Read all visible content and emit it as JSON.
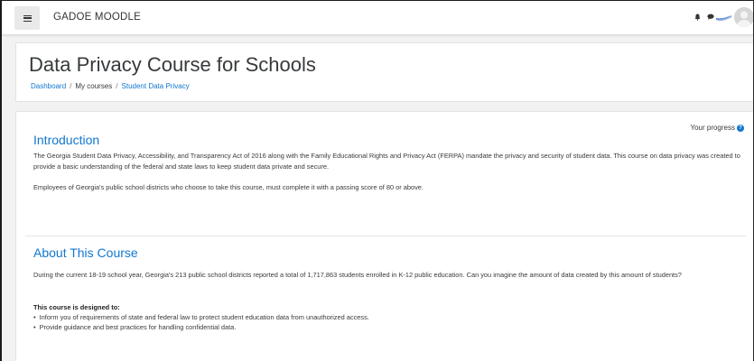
{
  "navbar": {
    "menu_icon": "hamburger-menu-icon",
    "brand": "GADOE MOODLE",
    "notifications_icon": "bell-icon",
    "messages_icon": "chat-bubble-icon",
    "avatar_icon": "user-avatar-icon"
  },
  "header": {
    "title": "Data Privacy Course for Schools",
    "breadcrumb": {
      "home": "Dashboard",
      "my_courses": "My courses",
      "current": "Student Data Privacy",
      "separator": "/"
    }
  },
  "main": {
    "progress_label": "Your progress",
    "progress_help_glyph": "?",
    "sections": [
      {
        "heading": "Introduction",
        "paragraphs": [
          "The Georgia Student Data Privacy, Accessibility, and Transparency Act of 2016 along with the Family Educational Rights and Privacy Act (FERPA) mandate the privacy and security of student data.  This course on data privacy was created to provide a basic understanding of the federal and state laws to keep student data private and secure.",
          "Employees of Georgia's public school districts who choose to take this course, must complete it with a passing score of 80 or above."
        ]
      },
      {
        "heading": "About This Course",
        "paragraphs": [
          "During the current 18-19 school year, Georgia's 213 public school districts reported a total of 1,717,863 students enrolled in K-12 public education.  Can you imagine the amount of data created by this amount of students?"
        ],
        "subheading": "This course is designed to:",
        "bullets": [
          "Inform you of requirements of state and federal law to protect student education data from unauthorized access.",
          "Provide guidance and best practices for handling confidential data."
        ]
      }
    ]
  },
  "colors": {
    "link": "#1177d1",
    "text": "#373a3c",
    "page_bg": "#f2f2f2",
    "card_bg": "#ffffff"
  }
}
